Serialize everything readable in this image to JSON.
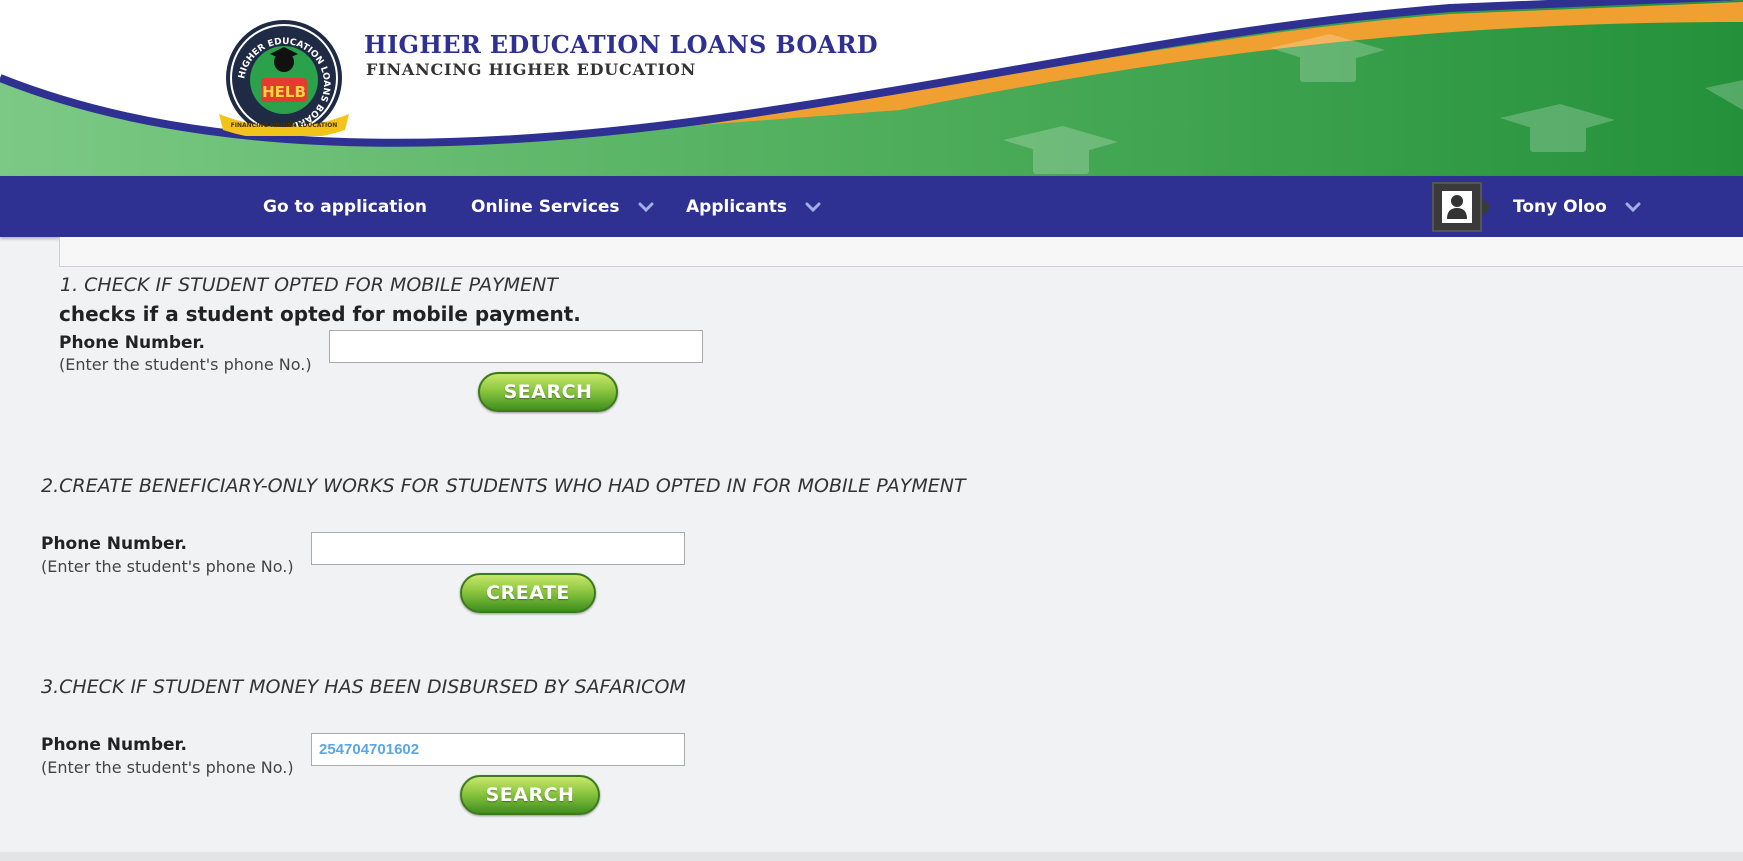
{
  "header": {
    "title": "HIGHER EDUCATION LOANS BOARD",
    "subtitle": "FINANCING HIGHER EDUCATION",
    "logo_text": "HELB",
    "logo_ring_text": "HIGHER EDUCATION LOANS BOARD",
    "logo_ribbon_text": "FINANCING HIGHER EDUCATION",
    "colors": {
      "brand_blue": "#2e3192",
      "green": "#2b9640",
      "orange": "#f0a030"
    }
  },
  "nav": {
    "items": [
      {
        "label": "Go to application",
        "has_dropdown": false
      },
      {
        "label": "Online Services",
        "has_dropdown": true
      },
      {
        "label": "Applicants",
        "has_dropdown": true
      }
    ],
    "user": {
      "name": "Tony Oloo",
      "icon": "user-avatar-icon"
    }
  },
  "sections": [
    {
      "title": "1. CHECK IF STUDENT OPTED FOR MOBILE PAYMENT",
      "description": "checks if a student opted for mobile payment.",
      "field_label": "Phone Number.",
      "field_hint": "(Enter the student's phone No.)",
      "value": "",
      "button_label": "SEARCH"
    },
    {
      "title": "2.CREATE BENEFICIARY-ONLY WORKS FOR STUDENTS WHO HAD OPTED IN FOR MOBILE PAYMENT",
      "field_label": "Phone Number.",
      "field_hint": "(Enter the student's phone No.)",
      "value": "",
      "button_label": "CREATE"
    },
    {
      "title": "3.CHECK IF STUDENT MONEY HAS BEEN DISBURSED BY SAFARICOM",
      "field_label": "Phone Number.",
      "field_hint": "(Enter the student's phone No.)",
      "value": "254704701602",
      "button_label": "SEARCH"
    }
  ]
}
